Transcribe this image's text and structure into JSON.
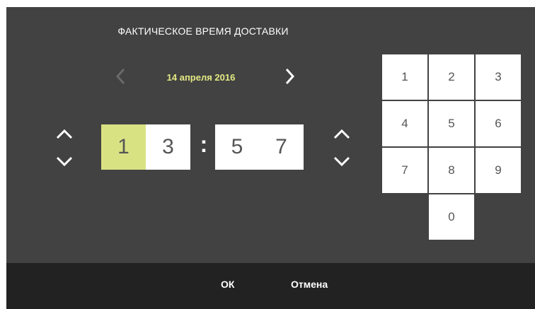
{
  "dialog": {
    "title": "ФАКТИЧЕСКОЕ ВРЕМЯ ДОСТАВКИ",
    "date": "14 апреля 2016",
    "prev_icon": "chevron-left-icon",
    "next_icon": "chevron-right-icon"
  },
  "time": {
    "digits": [
      "1",
      "3",
      "5",
      "7"
    ],
    "separator": ":"
  },
  "keypad": {
    "keys": [
      "1",
      "2",
      "3",
      "4",
      "5",
      "6",
      "7",
      "8",
      "9",
      "0"
    ]
  },
  "footer": {
    "ok_label": "ОК",
    "cancel_label": "Отмена"
  },
  "colors": {
    "background": "#424242",
    "footer": "#222222",
    "accent": "#d9e283",
    "date_text": "#e4e983"
  }
}
